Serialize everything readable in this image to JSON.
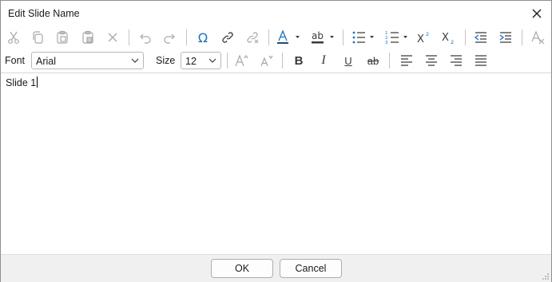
{
  "window": {
    "title": "Edit Slide Name",
    "close_icon": "close-icon"
  },
  "toolbar1": {
    "clipboard_icons": [
      "cut-icon",
      "copy-icon",
      "paste-icon",
      "paste-special-icon",
      "clear-icon"
    ],
    "history_icons": [
      "undo-icon",
      "redo-icon"
    ],
    "insert_icons": [
      "omega-symbol-icon",
      "link-icon",
      "unlink-icon"
    ],
    "color_icons": [
      "font-color-icon",
      "highlight-color-icon"
    ],
    "list_icons": [
      "bulleted-list-icon",
      "numbered-list-icon"
    ],
    "script_icons": [
      "superscript-icon",
      "subscript-icon"
    ],
    "indent_icons": [
      "decrease-indent-icon",
      "increase-indent-icon"
    ],
    "clear_format_icon": "clear-formatting-icon",
    "font_color": "#1f4e79",
    "accent_color": "#1e6fc4"
  },
  "toolbar2": {
    "font_label": "Font",
    "font_value": "Arial",
    "size_label": "Size",
    "size_value": "12",
    "size_icons": [
      "grow-font-icon",
      "shrink-font-icon"
    ],
    "style_icons": [
      "bold-icon",
      "italic-icon",
      "underline-icon",
      "strikethrough-icon"
    ],
    "align_icons": [
      "align-left-icon",
      "align-center-icon",
      "align-right-icon",
      "justify-icon"
    ]
  },
  "editor": {
    "text": "Slide 1"
  },
  "footer": {
    "ok_label": "OK",
    "cancel_label": "Cancel"
  }
}
